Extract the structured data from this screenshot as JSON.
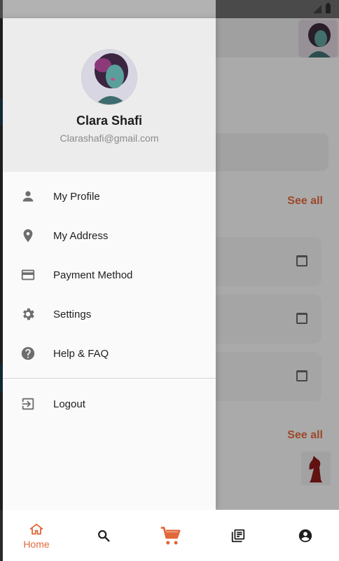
{
  "drawer": {
    "user": {
      "name": "Clara Shafi",
      "email": "Clarashafi@gmail.com"
    },
    "menu": [
      {
        "label": "My Profile",
        "icon": "person-icon"
      },
      {
        "label": "My Address",
        "icon": "location-pin-icon"
      },
      {
        "label": "Payment Method",
        "icon": "credit-card-icon"
      },
      {
        "label": "Settings",
        "icon": "gear-icon"
      },
      {
        "label": "Help & FAQ",
        "icon": "help-circle-icon"
      }
    ],
    "logout": {
      "label": "Logout",
      "icon": "logout-icon"
    }
  },
  "background": {
    "greeting_fragment": "!",
    "see_all_1": "See all",
    "see_all_2": "See all"
  },
  "bottom_nav": {
    "items": [
      {
        "label": "Home",
        "icon": "home-icon",
        "active": true
      },
      {
        "label": "",
        "icon": "search-icon"
      },
      {
        "label": "",
        "icon": "cart-icon"
      },
      {
        "label": "",
        "icon": "orders-icon"
      },
      {
        "label": "",
        "icon": "account-icon"
      }
    ]
  },
  "colors": {
    "accent": "#e2683c",
    "drawer_bg": "#fafafa",
    "header_bg": "#ececec",
    "icon_gray": "#6e6e6e"
  }
}
